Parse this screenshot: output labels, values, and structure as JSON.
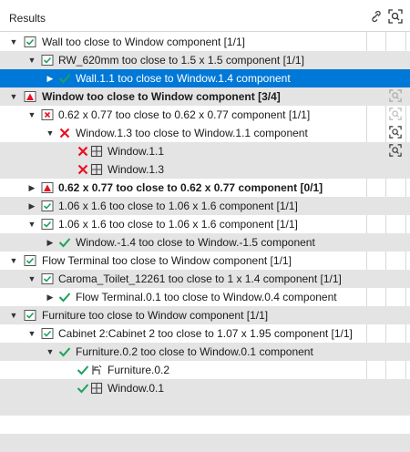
{
  "header": {
    "title": "Results"
  },
  "rows": [
    {
      "label": "Wall too close to Window component [1/1]",
      "bold": false
    },
    {
      "label": "RW_620mm too close to 1.5 x 1.5 component [1/1]",
      "bold": false
    },
    {
      "label": "Wall.1.1 too close to Window.1.4 component",
      "bold": false
    },
    {
      "label": "Window too close to Window component [3/4]",
      "bold": true
    },
    {
      "label": "0.62 x 0.77 too close to 0.62 x 0.77 component [1/1]",
      "bold": false
    },
    {
      "label": "Window.1.3 too close to Window.1.1 component",
      "bold": false
    },
    {
      "label": "Window.1.1",
      "bold": false
    },
    {
      "label": "Window.1.3",
      "bold": false
    },
    {
      "label": "0.62 x 0.77 too close to 0.62 x 0.77 component [0/1]",
      "bold": true
    },
    {
      "label": "1.06 x 1.6 too close to 1.06 x 1.6 component [1/1]",
      "bold": false
    },
    {
      "label": "1.06 x 1.6 too close to 1.06 x 1.6 component [1/1]",
      "bold": false
    },
    {
      "label": "Window.-1.4 too close to Window.-1.5 component",
      "bold": false
    },
    {
      "label": "Flow Terminal too close to Window component [1/1]",
      "bold": false
    },
    {
      "label": "Caroma_Toilet_12261 too close to 1 x 1.4 component [1/1]",
      "bold": false
    },
    {
      "label": "Flow Terminal.0.1 too close to Window.0.4 component",
      "bold": false
    },
    {
      "label": "Furniture too close to Window component [1/1]",
      "bold": false
    },
    {
      "label": "Cabinet 2:Cabinet 2 too close to 1.07 x 1.95 component [1/1]",
      "bold": false
    },
    {
      "label": "Furniture.0.2 too close to Window.0.1 component",
      "bold": false
    },
    {
      "label": "Furniture.0.2",
      "bold": false
    },
    {
      "label": "Window.0.1",
      "bold": false
    }
  ],
  "icons": {
    "header_col1": "link-icon",
    "header_col2": "zoom-to-fit-icon",
    "row_action": "zoom-to-fit-icon",
    "group_ok": "checkbox-checked-icon",
    "group_warn": "warning-triangle-icon",
    "group_err": "error-x-box-icon",
    "item_ok": "green-check-icon",
    "item_err": "red-x-icon",
    "window": "window-icon",
    "furniture": "furniture-icon"
  },
  "colors": {
    "selection": "#0078d7",
    "group_bg": "#e4e4e4",
    "ok_green": "#1aa35a",
    "err_red": "#e81123"
  }
}
